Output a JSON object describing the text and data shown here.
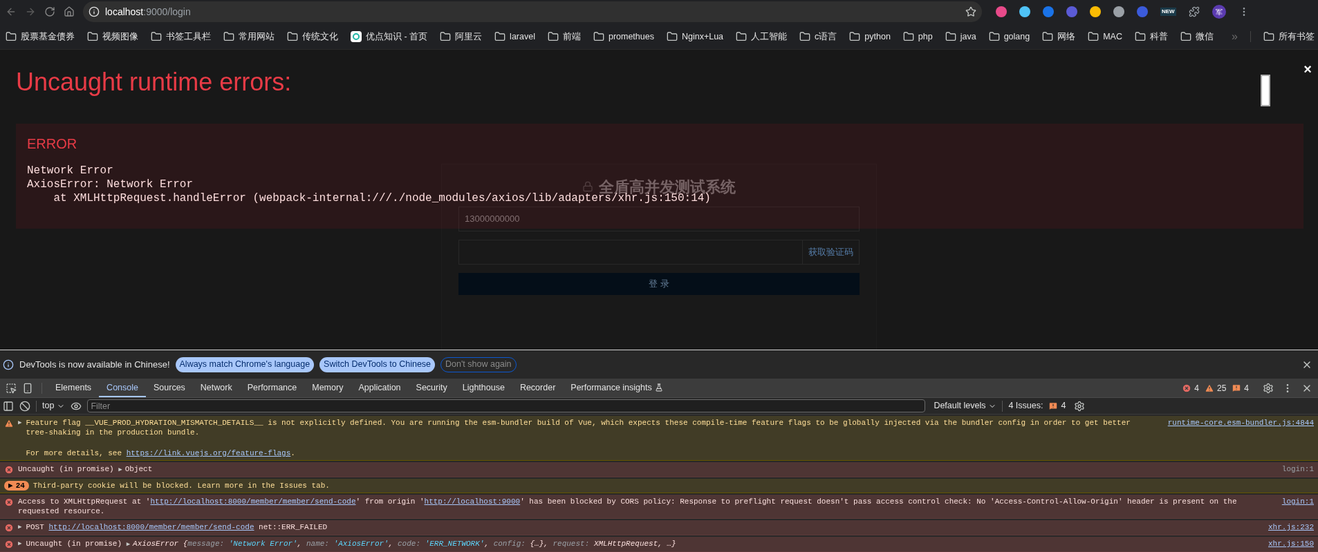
{
  "browser": {
    "url_host": "localhost",
    "url_path": ":9000/login",
    "bookmarks": [
      {
        "label": "股票基金债券",
        "kind": "folder"
      },
      {
        "label": "视频图像",
        "kind": "folder"
      },
      {
        "label": "书签工具栏",
        "kind": "folder"
      },
      {
        "label": "常用网站",
        "kind": "folder"
      },
      {
        "label": "传统文化",
        "kind": "folder"
      },
      {
        "label": "优点知识 - 首页",
        "kind": "site"
      },
      {
        "label": "阿里云",
        "kind": "folder"
      },
      {
        "label": "laravel",
        "kind": "folder"
      },
      {
        "label": "前端",
        "kind": "folder"
      },
      {
        "label": "promethues",
        "kind": "folder"
      },
      {
        "label": "Nginx+Lua",
        "kind": "folder"
      },
      {
        "label": "人工智能",
        "kind": "folder"
      },
      {
        "label": "c语言",
        "kind": "folder"
      },
      {
        "label": "python",
        "kind": "folder"
      },
      {
        "label": "php",
        "kind": "folder"
      },
      {
        "label": "java",
        "kind": "folder"
      },
      {
        "label": "golang",
        "kind": "folder"
      },
      {
        "label": "网络",
        "kind": "folder"
      },
      {
        "label": "MAC",
        "kind": "folder"
      },
      {
        "label": "科普",
        "kind": "folder"
      },
      {
        "label": "微信",
        "kind": "folder"
      }
    ],
    "more": "»",
    "all_bookmarks": "所有书签",
    "avatar": "军",
    "ext_badge": "NEW"
  },
  "login_page": {
    "title": "全盾高并发测试系统",
    "phone_value": "13000000000",
    "code_button": "获取验证码",
    "submit": "登 录"
  },
  "overlay": {
    "title": "Uncaught runtime errors:",
    "close": "×",
    "error_label": "ERROR",
    "error_lines": [
      "Network Error",
      "AxiosError: Network Error",
      "    at XMLHttpRequest.handleError (webpack-internal:///./node_modules/axios/lib/adapters/xhr.js:150:14)"
    ]
  },
  "devtools": {
    "banner": {
      "text": "DevTools is now available in Chinese!",
      "buttons": [
        {
          "label": "Always match Chrome's language",
          "kind": "primary"
        },
        {
          "label": "Switch DevTools to Chinese",
          "kind": "primary"
        },
        {
          "label": "Don't show again",
          "kind": "outline"
        }
      ]
    },
    "tabs": [
      {
        "label": "Elements",
        "selected": false
      },
      {
        "label": "Console",
        "selected": true
      },
      {
        "label": "Sources",
        "selected": false
      },
      {
        "label": "Network",
        "selected": false
      },
      {
        "label": "Performance",
        "selected": false
      },
      {
        "label": "Memory",
        "selected": false
      },
      {
        "label": "Application",
        "selected": false
      },
      {
        "label": "Security",
        "selected": false
      },
      {
        "label": "Lighthouse",
        "selected": false
      },
      {
        "label": "Recorder",
        "selected": false
      },
      {
        "label": "Performance insights",
        "selected": false
      }
    ],
    "counts": {
      "errors": "4",
      "warnings": "25",
      "issues": "4"
    },
    "toolbar": {
      "context": "top",
      "filter_placeholder": "Filter",
      "levels": "Default levels",
      "issues_label": "4 Issues:",
      "issues_count": "4"
    },
    "messages": [
      {
        "kind": "warning",
        "expand_arrow": "▶",
        "lines": [
          [
            {
              "kind": "text",
              "text": "Feature flag __VUE_PROD_HYDRATION_MISMATCH_DETAILS__ is not explicitly defined. You are running the esm-bundler build of Vue, which expects these compile-time feature flags to be globally injected via the bundler config in order to get better tree-shaking in the production bundle."
            }
          ],
          [
            {
              "kind": "text",
              "text": "For more details, see "
            },
            {
              "kind": "link",
              "text": "https://link.vuejs.org/feature-flags"
            },
            {
              "kind": "text",
              "text": "."
            }
          ]
        ],
        "source": "runtime-core.esm-bundler.js:4844",
        "source_link": true
      },
      {
        "kind": "error",
        "lines": [
          [
            {
              "kind": "text",
              "text": "Uncaught (in promise) "
            },
            {
              "kind": "arrow",
              "text": "▶"
            },
            {
              "kind": "text",
              "text": "Object"
            }
          ]
        ],
        "source": "login:1",
        "source_link": false
      },
      {
        "kind": "issue",
        "badge_arrow": "▶",
        "count": "24",
        "lines": [
          [
            {
              "kind": "text",
              "text": "Third-party cookie will be blocked. Learn more in the Issues tab."
            }
          ]
        ]
      },
      {
        "kind": "error",
        "lines": [
          [
            {
              "kind": "text",
              "text": "Access to XMLHttpRequest at '"
            },
            {
              "kind": "link",
              "text": "http://localhost:8000/member/member/send-code"
            },
            {
              "kind": "text",
              "text": "' from origin '"
            },
            {
              "kind": "link",
              "text": "http://localhost:9000"
            },
            {
              "kind": "text",
              "text": "' has been blocked by CORS policy: Response to preflight request doesn't pass access control check: No 'Access-Control-Allow-Origin' header is present on the requested resource."
            }
          ]
        ],
        "source": "login:1",
        "source_link": true
      },
      {
        "kind": "error",
        "expand_arrow": "▶",
        "lines": [
          [
            {
              "kind": "text",
              "text": "POST "
            },
            {
              "kind": "link",
              "text": "http://localhost:8000/member/member/send-code"
            },
            {
              "kind": "text",
              "text": " net::ERR_FAILED"
            }
          ]
        ],
        "source": "xhr.js:232",
        "source_link": true
      },
      {
        "kind": "error",
        "expand_arrow": "▶",
        "lines": [
          [
            {
              "kind": "text",
              "text": "Uncaught (in promise) "
            },
            {
              "kind": "arrow",
              "text": "▶"
            },
            {
              "kind": "italic",
              "text": "AxiosError {"
            },
            {
              "kind": "key",
              "text": "message: "
            },
            {
              "kind": "string",
              "text": "'Network Error'"
            },
            {
              "kind": "italic",
              "text": ", "
            },
            {
              "kind": "key",
              "text": "name: "
            },
            {
              "kind": "string",
              "text": "'AxiosError'"
            },
            {
              "kind": "italic",
              "text": ", "
            },
            {
              "kind": "key",
              "text": "code: "
            },
            {
              "kind": "string",
              "text": "'ERR_NETWORK'"
            },
            {
              "kind": "italic",
              "text": ", "
            },
            {
              "kind": "key",
              "text": "config: "
            },
            {
              "kind": "italic",
              "text": "{…}, "
            },
            {
              "kind": "key",
              "text": "request: "
            },
            {
              "kind": "italic",
              "text": "XMLHttpRequest, …}"
            }
          ]
        ],
        "source": "xhr.js:150",
        "source_link": true
      }
    ]
  }
}
